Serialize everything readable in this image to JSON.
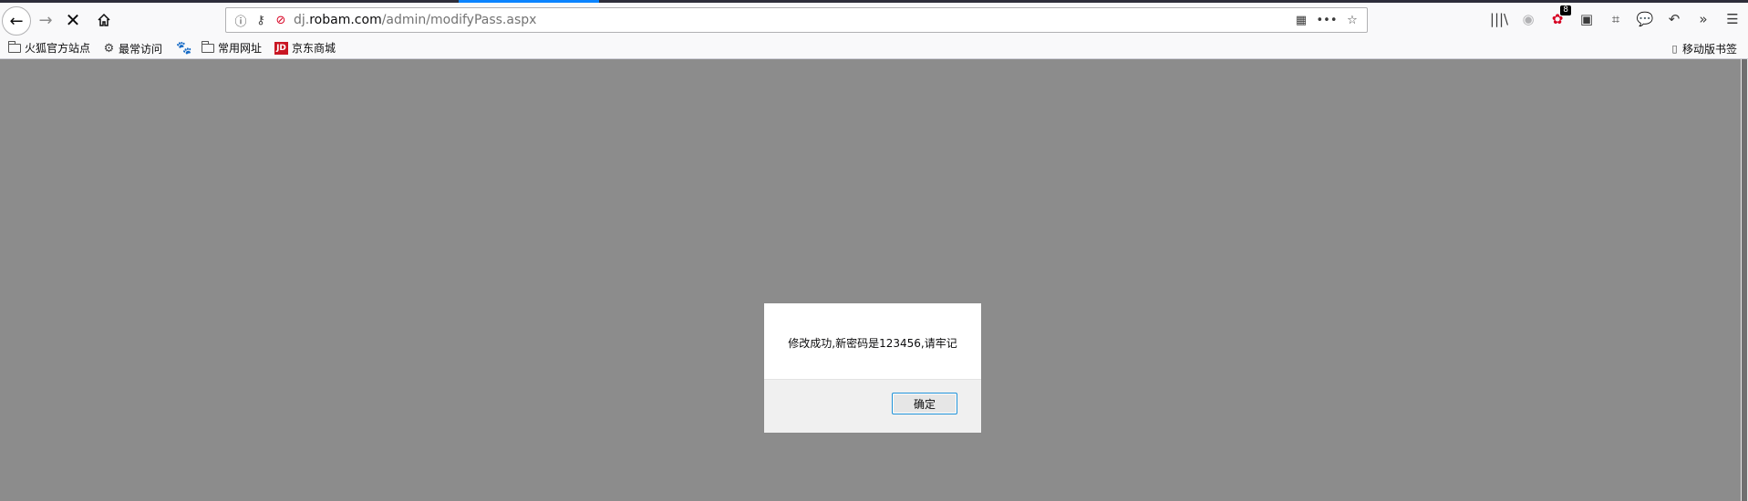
{
  "browser": {
    "url_prefix": "dj.",
    "url_host": "robam.com",
    "url_path": "/admin/modifyPass.aspx",
    "icons": {
      "back": "back-arrow-icon",
      "forward": "forward-arrow-icon",
      "stop": "stop-icon",
      "home": "home-icon"
    },
    "badge_count": "8"
  },
  "bookmarks": [
    {
      "label": "火狐官方站点",
      "icon": "folder-icon"
    },
    {
      "label": "最常访问",
      "icon": "gear-icon"
    },
    {
      "label": "",
      "icon": "baidu-icon"
    },
    {
      "label": "常用网址",
      "icon": "folder-icon"
    },
    {
      "label": "京东商城",
      "icon": "jd-icon"
    }
  ],
  "mobile_bookmarks": "移动版书签",
  "dialog": {
    "message": "修改成功,新密码是123456,请牢记",
    "ok_label": "确定"
  }
}
